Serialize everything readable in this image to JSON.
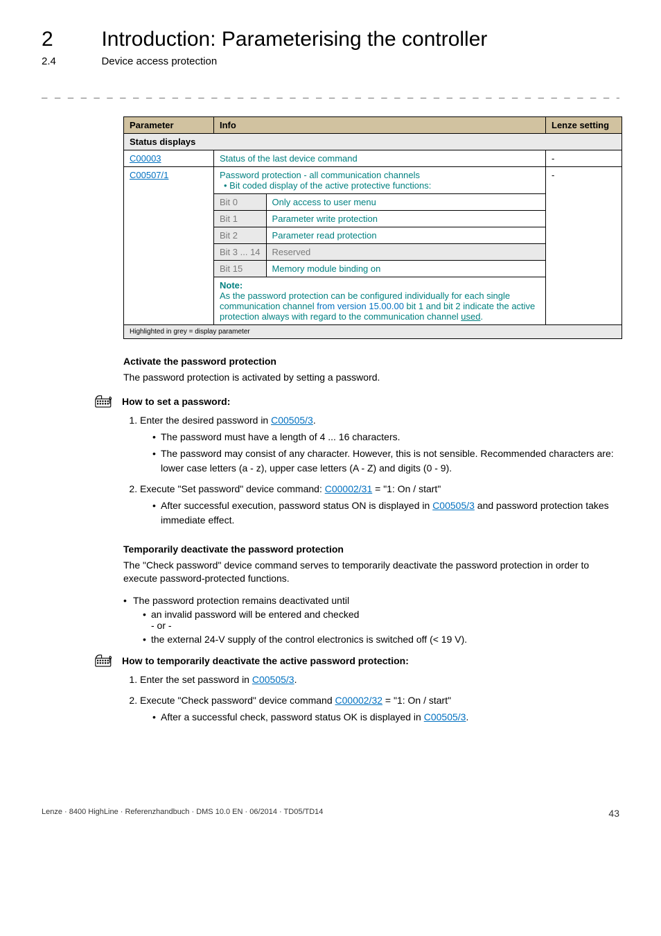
{
  "header": {
    "chapnum": "2",
    "chaptitle": "Introduction: Parameterising the controller",
    "secnum": "2.4",
    "sectitle": "Device access protection",
    "dashes": "_ _ _ _ _ _ _ _ _ _ _ _ _ _ _ _ _ _ _ _ _ _ _ _ _ _ _ _ _ _ _ _ _ _ _ _ _ _ _ _ _ _ _ _ _ _ _ _ _ _ _ _ _ _ _ _ _ _ _ _ _ _ _ _"
  },
  "table": {
    "cols": {
      "param": "Parameter",
      "info": "Info",
      "setting": "Lenze setting"
    },
    "status_row": "Status displays",
    "row1": {
      "param": "C00003",
      "info": "Status of the last device command",
      "setting": "-"
    },
    "row2": {
      "param": "C00507/1",
      "info_main_a": "Password protection - all communication channels",
      "info_main_b": "• Bit coded display of the active protective functions:",
      "bits": {
        "b0": {
          "label": "Bit 0",
          "text": "Only access to user menu"
        },
        "b1": {
          "label": "Bit 1",
          "text": "Parameter write protection"
        },
        "b2": {
          "label": "Bit 2",
          "text": "Parameter read protection"
        },
        "b3": {
          "label": "Bit 3 ... 14",
          "text": "Reserved"
        },
        "b4": {
          "label": "Bit 15",
          "text": "Memory module binding on"
        }
      },
      "note": {
        "head": "Note:",
        "body_a": "As the password protection can be configured individually for each single communication channel ",
        "body_b": "from version 15.00.00",
        "body_c": " bit 1 and bit 2 indicate the active protection always with regard to the communication channel ",
        "body_d": "used",
        "body_e": "."
      },
      "setting": "-"
    },
    "footnote": "Highlighted in grey = display parameter"
  },
  "activate": {
    "heading": "Activate the password protection",
    "intro": "The password protection is activated by setting a password.",
    "howto": "How to set a password:",
    "step1_a": "Enter the desired password in ",
    "step1_link": "C00505/3",
    "step1_b": ".",
    "step1_sub1": "The password must have a length of 4 ... 16 characters.",
    "step1_sub2": "The password may consist of any character. However, this is not sensible. Recommended characters are: lower case letters (a - z), upper case letters (A - Z) and digits (0 - 9).",
    "step2_a": "Execute \"Set password\" device command: ",
    "step2_link": "C00002/31",
    "step2_b": " = \"1: On / start\"",
    "step2_sub_a": "After successful execution, password status ON is displayed in ",
    "step2_sub_link": "C00505/3",
    "step2_sub_b": " and password protection takes immediate effect."
  },
  "temp": {
    "heading": "Temporarily deactivate the password protection",
    "intro": "The \"Check password\" device command serves to temporarily deactivate the password protection in order to execute password-protected functions.",
    "bullet_top": "The password protection remains deactivated until",
    "bullet_a": "an invalid password will be entered and checked",
    "bullet_or": "- or -",
    "bullet_b": "the external 24-V supply of the control electronics is switched off (< 19 V).",
    "howto": "How to temporarily deactivate the active password protection:",
    "step1_a": "Enter the set password in ",
    "step1_link": "C00505/3",
    "step1_b": ".",
    "step2_a": "Execute \"Check password\" device command ",
    "step2_link": "C00002/32",
    "step2_b": "  = \"1: On / start\"",
    "step2_sub_a": "After a successful check, password status OK is displayed in ",
    "step2_sub_link": "C00505/3",
    "step2_sub_b": "."
  },
  "footer": {
    "left": "Lenze · 8400 HighLine · Referenzhandbuch · DMS 10.0 EN · 06/2014 · TD05/TD14",
    "page": "43"
  }
}
